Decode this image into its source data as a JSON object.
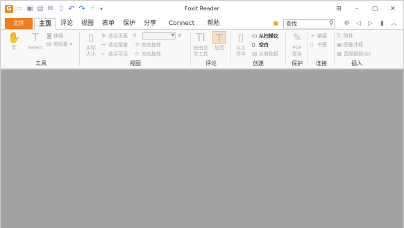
{
  "window": {
    "title": "Foxit Reader",
    "quick_access": {
      "icons": [
        "app-logo-icon",
        "open-icon",
        "save-icon",
        "print-icon",
        "email-icon",
        "new-icon",
        "undo-icon",
        "redo-icon",
        "hand-tool-icon",
        "customize-icon"
      ]
    },
    "controls": [
      "restore-tile-icon",
      "minimize-icon",
      "maximize-icon",
      "close-icon"
    ]
  },
  "tabs": {
    "file": "文件",
    "items": [
      {
        "label": "主页",
        "active": true
      },
      {
        "label": "评论",
        "active": false
      },
      {
        "label": "视图",
        "active": false
      },
      {
        "label": "表单",
        "active": false
      },
      {
        "label": "保护",
        "active": false
      },
      {
        "label": "分享",
        "active": false
      },
      {
        "label": "Connect",
        "active": false
      },
      {
        "label": "帮助",
        "active": false
      }
    ]
  },
  "search": {
    "value": "查找"
  },
  "ribbon": {
    "tools": {
      "title": "工具",
      "hand": "手",
      "select": "Select",
      "snapshot": "快照",
      "clipboard": "剪贴板"
    },
    "view": {
      "title": "视图",
      "actual_size_line1": "实际",
      "actual_size_line2": "大小",
      "fit_page": "适合页面",
      "fit_width": "适合宽度",
      "fit_visible": "适合可见",
      "rotate_left": "向左旋转",
      "rotate_right": "向右旋转"
    },
    "comment": {
      "title": "评论",
      "typewriter_line1": "自由文",
      "typewriter_line2": "本工具",
      "highlight": "加亮"
    },
    "create": {
      "title": "创建",
      "from_file_line1": "从文",
      "from_file_line2": "件中",
      "from_scanner": "从扫描仪",
      "blank": "空白",
      "from_clipboard": "从剪贴板"
    },
    "protect": {
      "title": "保护",
      "pdf_sign_line1": "PDF",
      "pdf_sign_line2": "签名"
    },
    "links": {
      "title": "连接",
      "link": "链接",
      "bookmark": "书签"
    },
    "insert": {
      "title": "插入",
      "attachment": "附件",
      "image_annotation": "图像注释",
      "audio_video": "音频视频(&)"
    }
  }
}
